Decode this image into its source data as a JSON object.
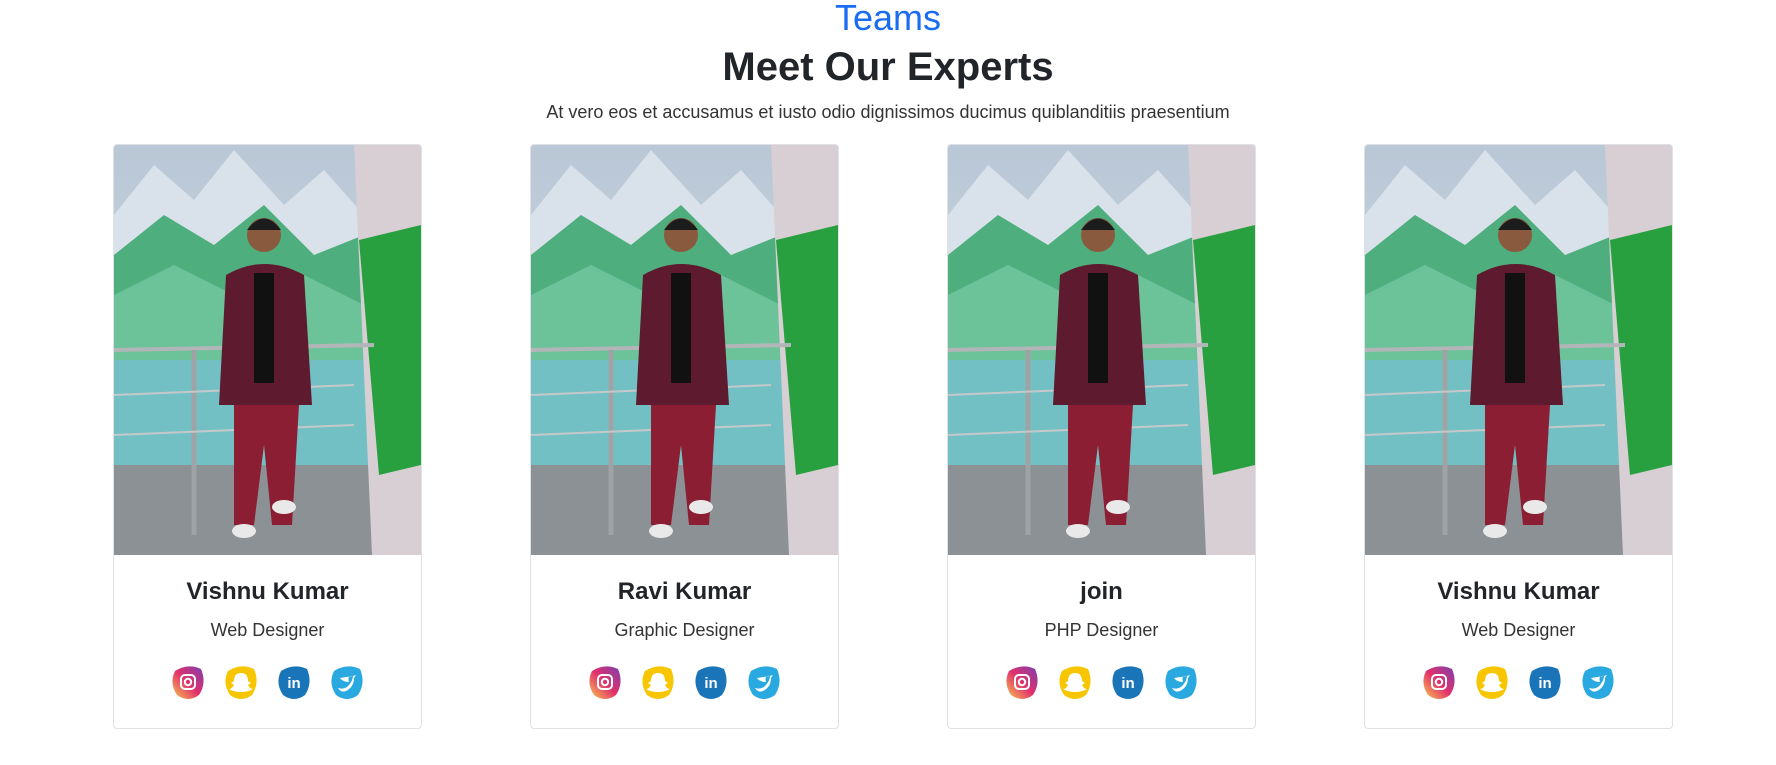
{
  "header": {
    "eyebrow": "Teams",
    "title": "Meet Our Experts",
    "subtitle": "At vero eos et accusamus et iusto odio dignissimos ducimus quiblanditiis praesentium"
  },
  "cards": [
    {
      "name": "Vishnu Kumar",
      "role": "Web Designer"
    },
    {
      "name": "Ravi Kumar",
      "role": "Graphic Designer"
    },
    {
      "name": "join",
      "role": "PHP Designer"
    },
    {
      "name": "Vishnu Kumar",
      "role": "Web Designer"
    }
  ],
  "social_icons": [
    "instagram-icon",
    "snapchat-icon",
    "linkedin-icon",
    "twitter-icon"
  ],
  "colors": {
    "accent": "#1a6cf0",
    "instagram": "#c13584",
    "snapchat": "#f7c600",
    "linkedin": "#1a75b8",
    "twitter": "#2aa9e0"
  }
}
